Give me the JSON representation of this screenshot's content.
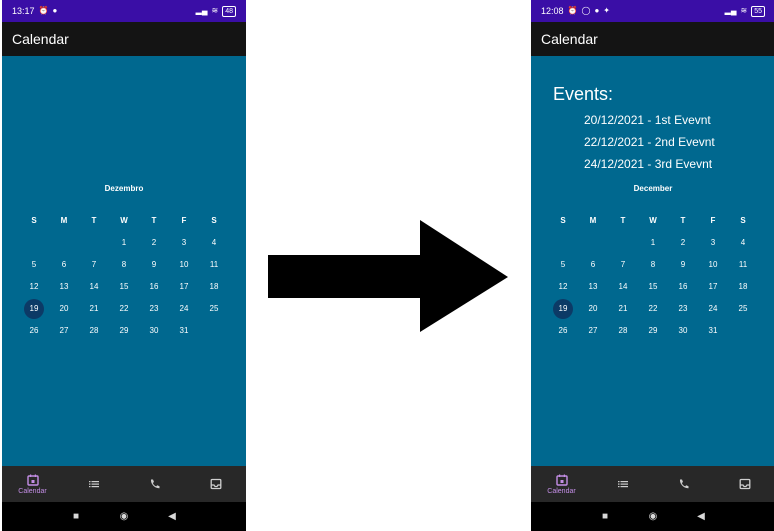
{
  "left": {
    "status": {
      "time": "13:17",
      "battery": "48"
    },
    "appbar_title": "Calendar",
    "month": "Dezembro",
    "weekdays": [
      "S",
      "M",
      "T",
      "W",
      "T",
      "F",
      "S"
    ],
    "weeks": [
      [
        "",
        "",
        "",
        "1",
        "2",
        "3",
        "4"
      ],
      [
        "5",
        "6",
        "7",
        "8",
        "9",
        "10",
        "11"
      ],
      [
        "12",
        "13",
        "14",
        "15",
        "16",
        "17",
        "18"
      ],
      [
        "19",
        "20",
        "21",
        "22",
        "23",
        "24",
        "25"
      ],
      [
        "26",
        "27",
        "28",
        "29",
        "30",
        "31",
        ""
      ]
    ],
    "selected_day": "19",
    "nav": [
      {
        "label": "Calendar",
        "icon": "calendar-icon",
        "active": true
      },
      {
        "label": "",
        "icon": "list-icon",
        "active": false
      },
      {
        "label": "",
        "icon": "phone-icon",
        "active": false
      },
      {
        "label": "",
        "icon": "inbox-icon",
        "active": false
      }
    ]
  },
  "right": {
    "status": {
      "time": "12:08",
      "battery": "55"
    },
    "appbar_title": "Calendar",
    "events_title": "Events:",
    "events": [
      "20/12/2021 - 1st Evevnt",
      "22/12/2021 - 2nd Evevnt",
      "24/12/2021 - 3rd Evevnt"
    ],
    "month": "December",
    "weekdays": [
      "S",
      "M",
      "T",
      "W",
      "T",
      "F",
      "S"
    ],
    "weeks": [
      [
        "",
        "",
        "",
        "1",
        "2",
        "3",
        "4"
      ],
      [
        "5",
        "6",
        "7",
        "8",
        "9",
        "10",
        "11"
      ],
      [
        "12",
        "13",
        "14",
        "15",
        "16",
        "17",
        "18"
      ],
      [
        "19",
        "20",
        "21",
        "22",
        "23",
        "24",
        "25"
      ],
      [
        "26",
        "27",
        "28",
        "29",
        "30",
        "31",
        ""
      ]
    ],
    "selected_day": "19",
    "nav": [
      {
        "label": "Calendar",
        "icon": "calendar-icon",
        "active": true
      },
      {
        "label": "",
        "icon": "list-icon",
        "active": false
      },
      {
        "label": "",
        "icon": "phone-icon",
        "active": false
      },
      {
        "label": "",
        "icon": "inbox-icon",
        "active": false
      }
    ]
  },
  "colors": {
    "calendar_bg": "#00688f",
    "status_bar": "#3a0ea6",
    "app_bar": "#141414",
    "selected_day": "#0c3a66",
    "nav_active": "#c48ee6",
    "arrow": "#000000"
  }
}
